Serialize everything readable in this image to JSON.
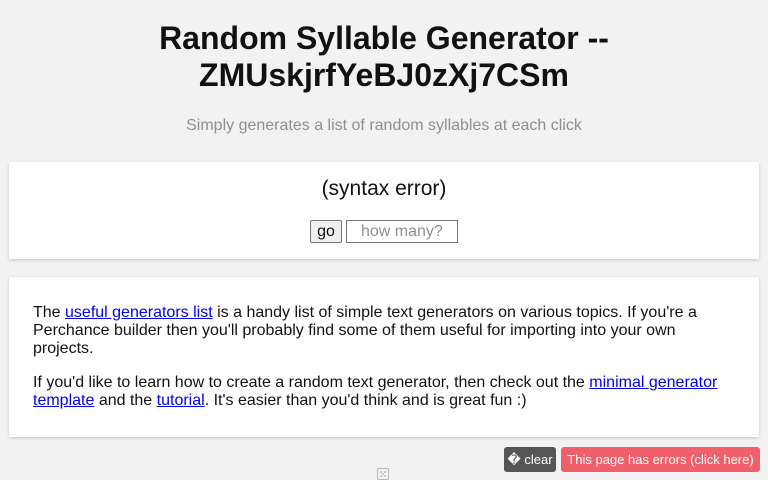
{
  "header": {
    "title": "Random Syllable Generator -- ZMUskjrfYeBJ0zXj7CSm",
    "subtitle": "Simply generates a list of random syllables at each click"
  },
  "generator": {
    "output": "(syntax error)",
    "go_label": "go",
    "count_placeholder": "how many?"
  },
  "info": {
    "p1_before": "The ",
    "p1_link": "useful generators list",
    "p1_after": " is a handy list of simple text generators on various topics. If you're a Perchance builder then you'll probably find some of them useful for importing into your own projects.",
    "p2_before": "If you'd like to learn how to create a random text generator, then check out the ",
    "p2_link1": "minimal generator template",
    "p2_middle": " and the ",
    "p2_link2": "tutorial",
    "p2_after": ". It's easier than you'd think and is great fun :)"
  },
  "footer": {
    "clear_icon": "trash-icon",
    "clear_label": " clear",
    "errors_label": "This page has errors (click here)",
    "dice_icon": "dice-icon"
  },
  "colors": {
    "background": "#f2f2f2",
    "link": "#0000ee",
    "clear_button": "#555555",
    "errors_button": "#f15f6a"
  }
}
